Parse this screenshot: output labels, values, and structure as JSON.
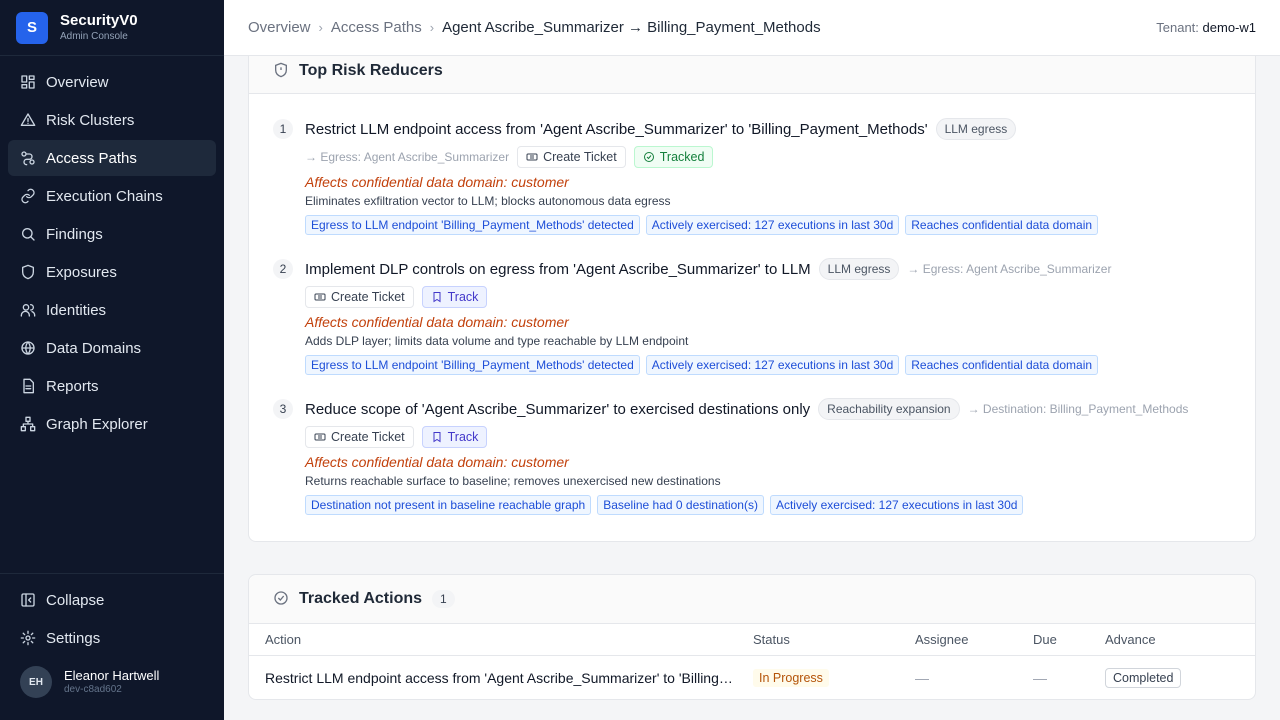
{
  "brand": {
    "initial": "S",
    "name": "SecurityV0",
    "subtitle": "Admin Console"
  },
  "nav": [
    {
      "label": "Overview",
      "icon": "dashboard-icon"
    },
    {
      "label": "Risk Clusters",
      "icon": "warning-icon"
    },
    {
      "label": "Access Paths",
      "icon": "path-icon",
      "active": true
    },
    {
      "label": "Execution Chains",
      "icon": "link-icon"
    },
    {
      "label": "Findings",
      "icon": "search-icon"
    },
    {
      "label": "Exposures",
      "icon": "shield-icon"
    },
    {
      "label": "Identities",
      "icon": "users-icon"
    },
    {
      "label": "Data Domains",
      "icon": "globe-icon"
    },
    {
      "label": "Reports",
      "icon": "report-icon"
    },
    {
      "label": "Graph Explorer",
      "icon": "graph-icon"
    }
  ],
  "sidebar_bottom": {
    "collapse": "Collapse",
    "settings": "Settings"
  },
  "user": {
    "initials": "EH",
    "name": "Eleanor Hartwell",
    "id": "dev-c8ad602"
  },
  "breadcrumb": {
    "c1": "Overview",
    "c2": "Access Paths",
    "c3": "Agent Ascribe_Summarizer → Billing_Payment_Methods"
  },
  "tenant": {
    "label": "Tenant:",
    "value": "demo-w1"
  },
  "risk_reducers": {
    "title": "Top Risk Reducers",
    "items": [
      {
        "num": "1",
        "title": "Restrict LLM endpoint access from 'Agent Ascribe_Summarizer' to 'Billing_Payment_Methods'",
        "pill": "LLM egress",
        "target": "→ Egress: Agent Ascribe_Summarizer",
        "ticket": "Create Ticket",
        "track": "Tracked",
        "affects": "Affects confidential data domain: customer",
        "desc": "Eliminates exfiltration vector to LLM; blocks autonomous data egress",
        "tags": [
          "Egress to LLM endpoint 'Billing_Payment_Methods' detected",
          "Actively exercised: 127 executions in last 30d",
          "Reaches confidential data domain"
        ]
      },
      {
        "num": "2",
        "title": "Implement DLP controls on egress from 'Agent Ascribe_Summarizer' to LLM",
        "pill": "LLM egress",
        "target": "→ Egress: Agent Ascribe_Summarizer",
        "ticket": "Create Ticket",
        "track": "Track",
        "affects": "Affects confidential data domain: customer",
        "desc": "Adds DLP layer; limits data volume and type reachable by LLM endpoint",
        "tags": [
          "Egress to LLM endpoint 'Billing_Payment_Methods' detected",
          "Actively exercised: 127 executions in last 30d",
          "Reaches confidential data domain"
        ]
      },
      {
        "num": "3",
        "title": "Reduce scope of 'Agent Ascribe_Summarizer' to exercised destinations only",
        "pill": "Reachability expansion",
        "target": "→ Destination: Billing_Payment_Methods",
        "ticket": "Create Ticket",
        "track": "Track",
        "affects": "Affects confidential data domain: customer",
        "desc": "Returns reachable surface to baseline; removes unexercised new destinations",
        "tags": [
          "Destination not present in baseline reachable graph",
          "Baseline had 0 destination(s)",
          "Actively exercised: 127 executions in last 30d"
        ]
      }
    ]
  },
  "tracked": {
    "title": "Tracked Actions",
    "count": "1",
    "columns": {
      "action": "Action",
      "status": "Status",
      "assignee": "Assignee",
      "due": "Due",
      "advance": "Advance"
    },
    "rows": [
      {
        "action": "Restrict LLM endpoint access from 'Agent Ascribe_Summarizer' to 'Billing_Payment_Methods'",
        "status": "In Progress",
        "assignee": "—",
        "due": "—",
        "advance": "Completed"
      }
    ]
  },
  "colors": {
    "sidebar_bg": "#0f172a",
    "brand_accent": "#2563eb",
    "affects_text": "#c2410c",
    "tag_blue": "#1d4ed8",
    "tracked_green": "#15803d"
  }
}
